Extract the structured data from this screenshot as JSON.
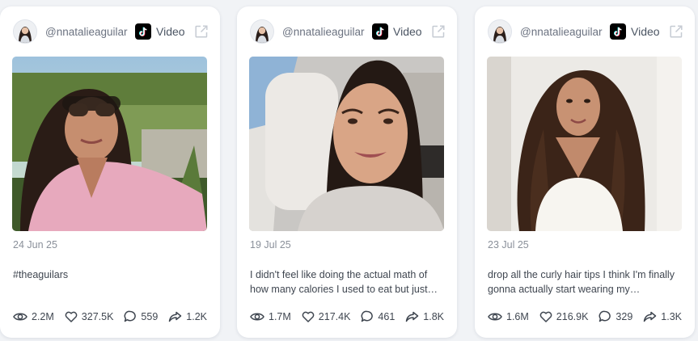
{
  "cards": [
    {
      "username": "@nnatalieaguilar",
      "platform_icon": "tiktok-icon",
      "content_type": "Video",
      "date": "24 Jun 25",
      "caption": "#theaguilars",
      "stats": {
        "views": "2.2M",
        "likes": "327.5K",
        "comments": "559",
        "shares": "1.2K"
      }
    },
    {
      "username": "@nnatalieaguilar",
      "platform_icon": "tiktok-icon",
      "content_type": "Video",
      "date": "19 Jul 25",
      "caption": "I didn't feel like doing the actual math of how many calories I used to eat but just…",
      "stats": {
        "views": "1.7M",
        "likes": "217.4K",
        "comments": "461",
        "shares": "1.8K"
      }
    },
    {
      "username": "@nnatalieaguilar",
      "platform_icon": "tiktok-icon",
      "content_type": "Video",
      "date": "23 Jul 25",
      "caption": "drop all the curly hair tips I think I'm finally gonna actually start wearing my…",
      "stats": {
        "views": "1.6M",
        "likes": "216.9K",
        "comments": "329",
        "shares": "1.3K"
      }
    }
  ],
  "colors": {
    "card_bg": "#ffffff",
    "page_bg": "#f1f3f6",
    "muted_text": "#8a909a",
    "body_text": "#3f4650",
    "icon_stroke": "#3f4650"
  }
}
